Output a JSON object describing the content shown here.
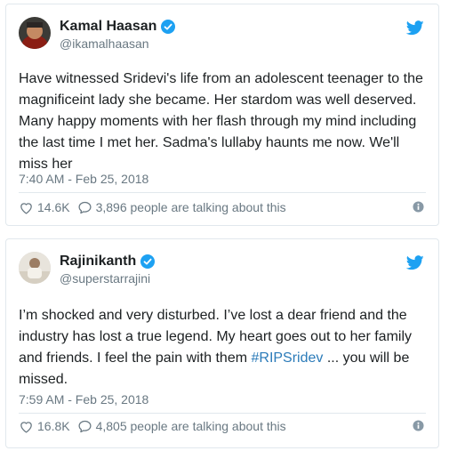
{
  "tweets": [
    {
      "author": "Kamal Haasan",
      "handle": "@ikamalhaasan",
      "text": "Have witnessed Sridevi's life from  an adolescent teenager to the magnificeint lady she became. Her stardom was well deserved. Many happy moments with her flash through my mind including the last time I met her. Sadma's lullaby haunts me now. We'll miss her",
      "timestamp": "7:40 AM - Feb 25, 2018",
      "likes": "14.6K",
      "talking": "3,896 people are talking about this"
    },
    {
      "author": "Rajinikanth",
      "handle": "@superstarrajini",
      "text_before": "I’m shocked and very disturbed. I’ve lost a dear friend and the industry has lost a true legend. My heart goes out to her family and friends. I feel the pain with them ",
      "hashtag": "#RIPSridev",
      "text_after": " ... you will be missed.",
      "timestamp": "7:59 AM - Feb 25, 2018",
      "likes": "16.8K",
      "talking": "4,805 people are talking about this"
    }
  ],
  "colors": {
    "verified": "#1da1f2",
    "bird": "#1da1f2",
    "hashtag": "#2b7bb9",
    "muted": "#697882"
  },
  "icons": [
    "verified-badge-icon",
    "twitter-bird-icon",
    "heart-icon",
    "comment-bubble-icon",
    "info-icon"
  ]
}
